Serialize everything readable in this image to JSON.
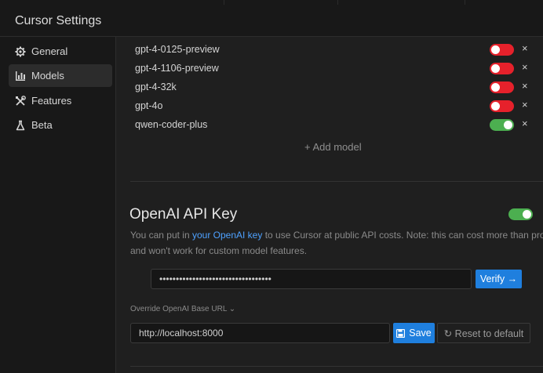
{
  "app": {
    "title": "Cursor Settings"
  },
  "sidebar": {
    "items": [
      {
        "label": "General",
        "icon": "gear-icon",
        "active": false
      },
      {
        "label": "Models",
        "icon": "bar-chart-icon",
        "active": true
      },
      {
        "label": "Features",
        "icon": "tools-icon",
        "active": false
      },
      {
        "label": "Beta",
        "icon": "flask-icon",
        "active": false
      }
    ]
  },
  "models": {
    "rows": [
      {
        "name": "gpt-4-0125-preview",
        "enabled": false
      },
      {
        "name": "gpt-4-1106-preview",
        "enabled": false
      },
      {
        "name": "gpt-4-32k",
        "enabled": false
      },
      {
        "name": "gpt-4o",
        "enabled": false
      },
      {
        "name": "qwen-coder-plus",
        "enabled": true
      }
    ],
    "remove_glyph": "×",
    "add_model_label": "+ Add model"
  },
  "openai": {
    "title": "OpenAI API Key",
    "enabled": true,
    "desc_prefix": "You can put in ",
    "desc_link": "your OpenAI key",
    "desc_suffix": " to use Cursor at public API costs. Note: this can cost more than pro",
    "desc_line2": "and won't work for custom model features.",
    "key_value": "••••••••••••••••••••••••••••••••••",
    "verify_label": "Verify →",
    "override_label": "Override OpenAI Base URL ⌄",
    "base_url": "http://localhost:8000",
    "save_label": "Save",
    "reset_label": "↻ Reset to default"
  },
  "colors": {
    "toggle_off": "#e6212b",
    "toggle_on": "#4caf50",
    "accent_blue": "#1f7fde",
    "link_blue": "#4ea1ff"
  }
}
